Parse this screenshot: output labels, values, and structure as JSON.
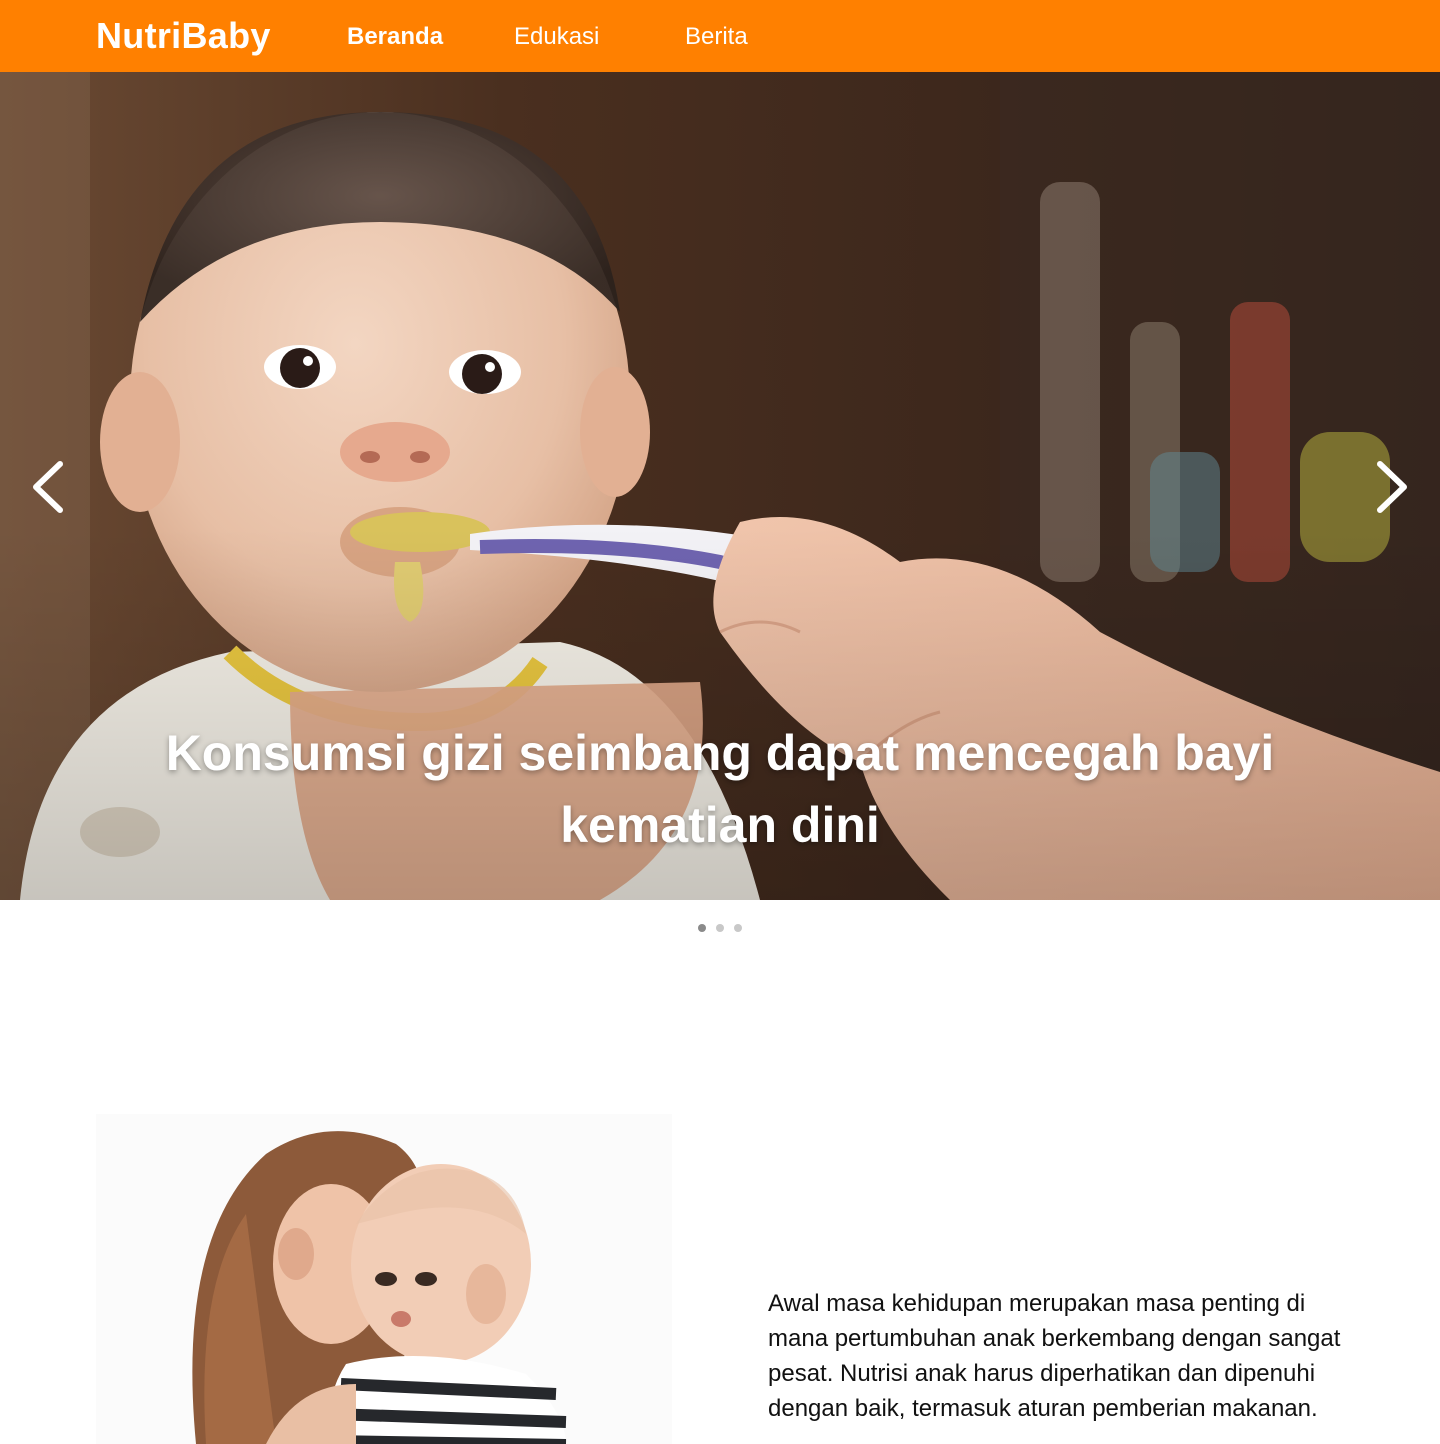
{
  "brand": "NutriBaby",
  "nav": {
    "home": "Beranda",
    "education": "Edukasi",
    "news": "Berita"
  },
  "hero": {
    "caption": "Konsumsi gizi seimbang dapat mencegah bayi kematian dini",
    "prev_icon": "chevron-left-icon",
    "next_icon": "chevron-right-icon",
    "slide_count": 3,
    "active_slide": 1
  },
  "intro": {
    "text": "Awal masa kehidupan merupakan masa penting di mana pertumbuhan anak berkembang dengan sangat pesat. Nutrisi anak harus diperhatikan dan dipenuhi dengan baik, termasuk aturan pemberian makanan."
  },
  "colors": {
    "navbar": "#ff8000",
    "text": "#111111",
    "indicator_active": "#8a8a8a",
    "indicator_inactive": "#c8c8c8"
  }
}
